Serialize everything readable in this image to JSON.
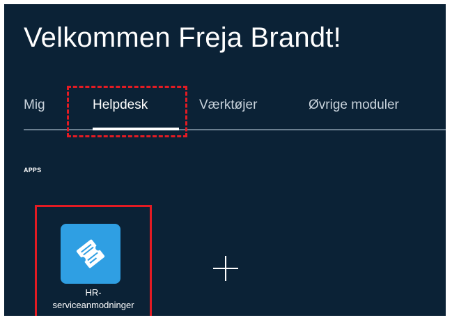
{
  "header": {
    "welcome": "Velkommen Freja Brandt!"
  },
  "tabs": [
    {
      "label": "Mig"
    },
    {
      "label": "Helpdesk",
      "active": true
    },
    {
      "label": "Værktøjer"
    },
    {
      "label": "Øvrige moduler"
    }
  ],
  "apps": {
    "section_label": "APPS",
    "items": [
      {
        "label_line1": "HR-",
        "label_line2": "serviceanmodninger",
        "icon": "ticket-icon",
        "icon_bg": "#2f9fe3"
      }
    ],
    "add_icon": "plus-icon"
  },
  "colors": {
    "background": "#0b2236",
    "highlight": "#e31b23",
    "tab_line": "#6b7f90"
  }
}
